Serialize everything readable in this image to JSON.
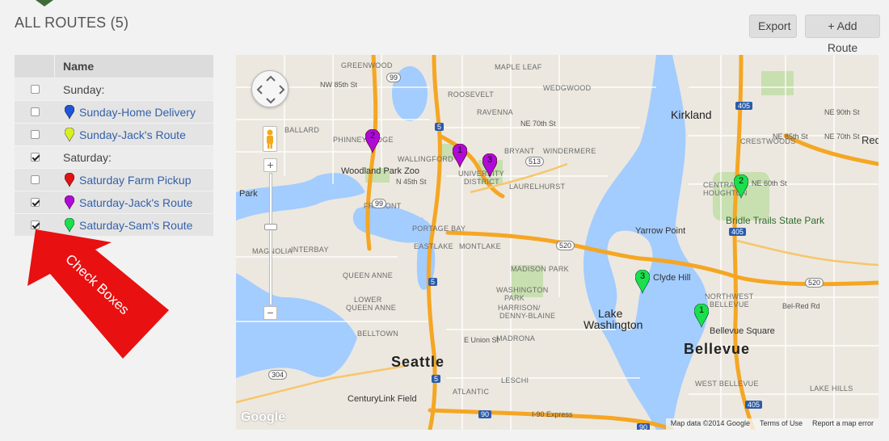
{
  "page": {
    "title": "ALL ROUTES (5)"
  },
  "toolbar": {
    "export_label": "Export",
    "add_route_label": "+ Add Route"
  },
  "table": {
    "header_name": "Name",
    "rows": [
      {
        "type": "group",
        "label": "Sunday:",
        "checked": false
      },
      {
        "type": "route",
        "label": "Sunday-Home Delivery",
        "checked": false,
        "color": "#1f56d9"
      },
      {
        "type": "route",
        "label": "Sunday-Jack's Route",
        "checked": false,
        "color": "#d9f020"
      },
      {
        "type": "group",
        "label": "Saturday:",
        "checked": true
      },
      {
        "type": "route",
        "label": "Saturday Farm Pickup",
        "checked": false,
        "color": "#e01212"
      },
      {
        "type": "route",
        "label": "Saturday-Jack's Route",
        "checked": true,
        "color": "#b00ad8"
      },
      {
        "type": "route",
        "label": "Saturday-Sam's Route",
        "checked": true,
        "color": "#19e04c"
      }
    ]
  },
  "callout": {
    "text": "Check Boxes",
    "color": "#e81010"
  },
  "map": {
    "labels": {
      "seattle": "Seattle",
      "kirkland": "Kirkland",
      "bellevue": "Bellevue",
      "lake_washington_1": "Lake",
      "lake_washington_2": "Washington",
      "woodland": "Woodland Park Zoo",
      "university": "UNIVERSITY",
      "district": "DISTRICT",
      "laurelhurst": "LAURELHURST",
      "ravenna": "RAVENNA",
      "bryant": "BRYANT",
      "windermere": "WINDERMERE",
      "wedgwood": "WEDGWOOD",
      "greenwood": "GREENWOOD",
      "maple_leaf": "MAPLE LEAF",
      "roosevelt": "ROOSEVELT",
      "phinney": "PHINNEY RIDGE",
      "ballard": "BALLARD",
      "fremont": "FREMONT",
      "wallingford": "WALLINGFORD",
      "eastlake": "EASTLAKE",
      "montlake": "MONTLAKE",
      "portage": "PORTAGE BAY",
      "magnolia": "MAGNOLIA",
      "interbay": "INTERBAY",
      "queen_anne": "QUEEN ANNE",
      "lower_qa_1": "LOWER",
      "lower_qa_2": "QUEEN ANNE",
      "madison_park": "MADISON PARK",
      "washington_park_1": "WASHINGTON",
      "washington_park_2": "PARK",
      "harrison": "HARRISON/",
      "denny": "DENNY-BLAINE",
      "madrona": "MADRONA",
      "belltown": "BELLTOWN",
      "leschi": "LESCHI",
      "atlantic": "ATLANTIC",
      "centurylink": "CenturyLink Field",
      "yarrow": "Yarrow Point",
      "clyde": "Clyde Hill",
      "bridle": "Bridle Trails State Park",
      "crestwoods": "CRESTWOODS",
      "houghton": "HOUGHTON",
      "central": "CENTRAL",
      "bellevue_sq": "Bellevue Square",
      "nw_bellevue_1": "NORTHWEST",
      "nw_bellevue_2": "BELLEVUE",
      "west_bellevue": "WEST BELLEVUE",
      "lake_hills": "LAKE HILLS",
      "park": "Park",
      "redmond": "Red",
      "nw85": "NW 85th St",
      "ne70": "NE 70th St",
      "n45": "N 45th St",
      "ne85": "NE 85th St",
      "ne60": "NE 60th St",
      "e_union": "E Union St",
      "i90": "I-90 Express",
      "bel_red": "Bel-Red Rd",
      "ne90": "NE 90th St",
      "ne70b": "NE 70th St"
    },
    "shields": {
      "i5_a": "5",
      "i5_b": "5",
      "i5_c": "5",
      "i405_a": "405",
      "i405_b": "405",
      "i405_c": "405",
      "r99_a": "99",
      "r99_b": "99",
      "r520_a": "520",
      "r520_b": "520",
      "r513": "513",
      "r304": "304",
      "i90": "90",
      "i90b": "90"
    },
    "markers": [
      {
        "num": "2",
        "color": "#b00ad8"
      },
      {
        "num": "1",
        "color": "#b00ad8"
      },
      {
        "num": "3",
        "color": "#b00ad8"
      },
      {
        "num": "2",
        "color": "#19e04c"
      },
      {
        "num": "3",
        "color": "#19e04c"
      },
      {
        "num": "1",
        "color": "#19e04c"
      }
    ],
    "google": "Google",
    "attribution": {
      "map_data": "Map data ©2014 Google",
      "terms": "Terms of Use",
      "report": "Report a map error"
    }
  }
}
